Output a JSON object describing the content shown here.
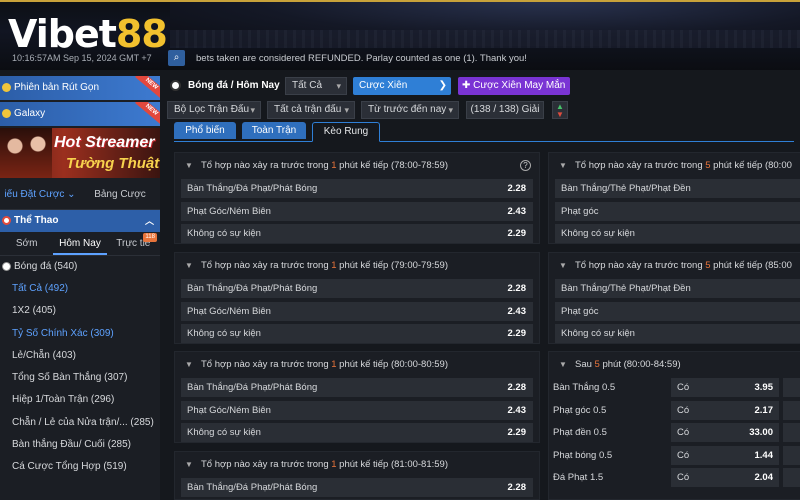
{
  "header": {
    "logo_white": "Vibet",
    "logo_gold": "88",
    "clock": "10:16:57AM Sep 15, 2024 GMT +7",
    "ticker": "bets taken are considered REFUNDED. Parlay counted as one (1). Thank you!"
  },
  "sidebar": {
    "promo1": "Phiên bản Rút Gọn",
    "promo_new": "NEW",
    "promo2": "Galaxy",
    "banner_line1": "Hot Streamer",
    "banner_line2": "Tường Thuật",
    "tab_bet_slip": "iếu Đặt Cược",
    "tab_odds": "Bảng Cược",
    "sports_head": "Thể Thao",
    "time_tabs": [
      "Sớm",
      "Hôm Nay",
      "Trực tiế"
    ],
    "live_badge": "118",
    "soccer": "Bóng đá",
    "soccer_count": "(540)",
    "items": [
      "Tất Cả (492)",
      "1X2 (405)",
      "Tỷ Số Chính Xác (309)",
      "Lẻ/Chẵn (403)",
      "Tổng Số Bàn Thắng (307)",
      "Hiệp 1/Toàn Trận (296)",
      "Chẵn / Lẻ của Nửa trận/... (285)",
      "Bàn thắng Đầu/ Cuối (285)",
      "Cá Cược Tổng Hợp (519)"
    ]
  },
  "toolbar": {
    "title": "Bóng đá / Hôm Nay",
    "filter_all": "Tất Cả",
    "parlay": "Cược Xiên",
    "lucky_parlay": "Cược Xiên May Mắn",
    "filter_league": "Bộ Lọc Trận Đấu",
    "filter_matches": "Tất cả trận đấu",
    "filter_time": "Từ trước đến nay",
    "count": "(138 / 138) Giải"
  },
  "market_tabs": [
    "Phổ biến",
    "Toàn Trận",
    "Kèo Rung"
  ],
  "panels_left": [
    {
      "pre": "Tổ hợp nào xảy ra trước trong ",
      "num": "1",
      "post": " phút kế tiếp (78:00-78:59)",
      "rows": [
        [
          "Bàn Thắng/Đá Phạt/Phát Bóng",
          "2.28"
        ],
        [
          "Phạt Góc/Ném Biên",
          "2.43"
        ],
        [
          "Không có sự kiện",
          "2.29"
        ]
      ]
    },
    {
      "pre": "Tổ hợp nào xảy ra trước trong ",
      "num": "1",
      "post": " phút kế tiếp (79:00-79:59)",
      "rows": [
        [
          "Bàn Thắng/Đá Phạt/Phát Bóng",
          "2.28"
        ],
        [
          "Phạt Góc/Ném Biên",
          "2.43"
        ],
        [
          "Không có sự kiện",
          "2.29"
        ]
      ]
    },
    {
      "pre": "Tổ hợp nào xảy ra trước trong ",
      "num": "1",
      "post": " phút kế tiếp (80:00-80:59)",
      "rows": [
        [
          "Bàn Thắng/Đá Phạt/Phát Bóng",
          "2.28"
        ],
        [
          "Phạt Góc/Ném Biên",
          "2.43"
        ],
        [
          "Không có sự kiện",
          "2.29"
        ]
      ]
    },
    {
      "pre": "Tổ hợp nào xảy ra trước trong ",
      "num": "1",
      "post": " phút kế tiếp (81:00-81:59)",
      "rows": [
        [
          "Bàn Thắng/Đá Phạt/Phát Bóng",
          "2.28"
        ]
      ]
    }
  ],
  "panels_right": [
    {
      "pre": "Tổ hợp nào xảy ra trước trong ",
      "num": "5",
      "post": " phút kế tiếp (80:00",
      "rows": [
        [
          "Bàn Thắng/Thẻ Phạt/Phạt Đền"
        ],
        [
          "Phạt góc"
        ],
        [
          "Không có sự kiện"
        ]
      ]
    },
    {
      "pre": "Tổ hợp nào xảy ra trước trong ",
      "num": "5",
      "post": " phút kế tiếp (85:00",
      "rows": [
        [
          "Bàn Thắng/Thẻ Phạt/Phạt Đền"
        ],
        [
          "Phạt góc"
        ],
        [
          "Không có sự kiện"
        ]
      ]
    }
  ],
  "panel_after": {
    "pre": "Sau ",
    "num": "5",
    "post": " phút (80:00-84:59)",
    "rows": [
      [
        "Bàn Thắng 0.5",
        "Có",
        "3.95"
      ],
      [
        "Phạt góc 0.5",
        "Có",
        "2.17"
      ],
      [
        "Phạt đền 0.5",
        "Có",
        "33.00"
      ],
      [
        "Phạt bóng 0.5",
        "Có",
        "1.44"
      ],
      [
        "Đá Phạt 1.5",
        "Có",
        "2.04"
      ]
    ]
  },
  "colors": {
    "accent_blue": "#2f7fd6",
    "accent_purple": "#7a34d4",
    "highlight_orange": "#e8743b",
    "gold": "#f2c12e"
  }
}
